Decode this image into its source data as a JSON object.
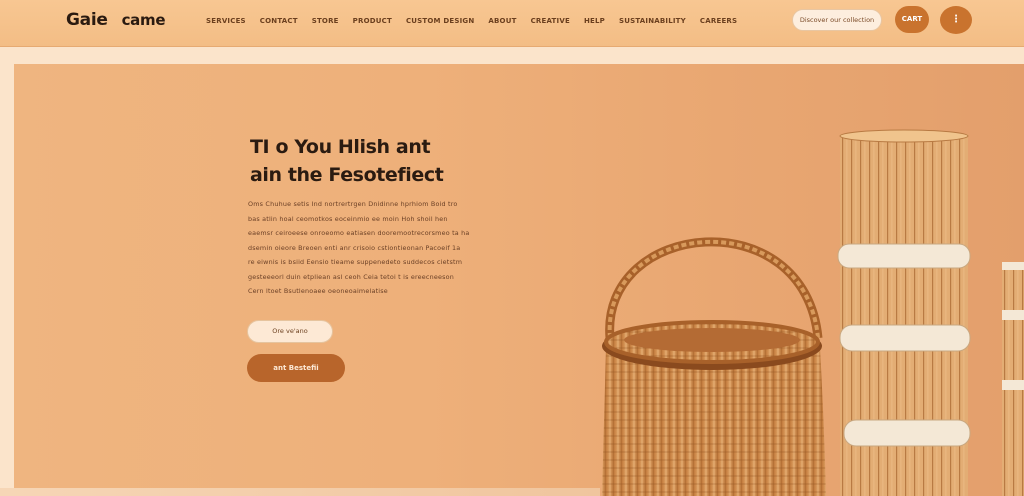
{
  "header": {
    "logo_part1": "Gaie",
    "logo_part2": "came",
    "nav": [
      "SERVICES",
      "CONTACT",
      "STORE",
      "PRODUCT",
      "CUSTOM DESIGN",
      "ABOUT",
      "CREATIVE",
      "HELP",
      "SUSTAINABILITY",
      "CAREERS"
    ],
    "pill_label": "Discover our collection",
    "icon_button_1_label": "CART",
    "icon_button_2_label": "⋮"
  },
  "hero": {
    "title_line1": "TI o You Hlish ant",
    "title_line2": "ain the Fesotefiect",
    "body_lines": [
      "Oms Chuhue  setis Ind nortrertrgen Dnidinne hprhiom Boid tro",
      "bas atlin hoal ceomotkos  eoceinmio ee moin Hoh shoil hen",
      "eaemsr ceiroeese onroeomo eatiasen dooremootrecorsmeo ta ha",
      "dsemin oieore  Breoen enti anr crisoio cstiontieonan  Pacoeif  1a",
      "re eiwnis is bsiid Eensio  tieame  suppenedeto suddecos cietstm",
      "gesteeeorl duin etpliean asl ceoh Ceia tetoi t is  ereecneeson",
      "Cern ltoet   Bsutlenoaee oeoneoaimelatise"
    ],
    "button_secondary": "Ore ve'ano",
    "button_primary": "ant Bestefii"
  },
  "colors": {
    "accent": "#b8652b",
    "header_bg": "#f6c592",
    "hero_bg": "#eeb07a"
  }
}
